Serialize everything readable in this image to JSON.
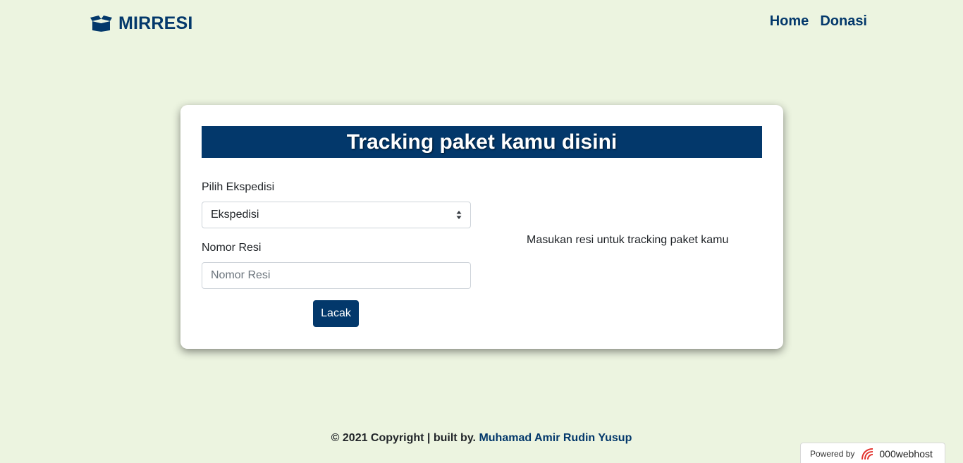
{
  "navbar": {
    "brand": "MIRRESI",
    "brand_icon": "box-open-icon",
    "links": [
      "Home",
      "Donasi"
    ]
  },
  "card": {
    "title": "Tracking paket kamu disini",
    "expedition_label": "Pilih Ekspedisi",
    "expedition_selected": "Ekspedisi",
    "resi_label": "Nomor Resi",
    "resi_placeholder": "Nomor Resi",
    "resi_value": "",
    "submit_label": "Lacak",
    "result_message": "Masukan resi untuk tracking paket kamu"
  },
  "footer": {
    "text": "© 2021 Copyright | built by.",
    "author": "Muhamad Amir Rudin Yusup"
  },
  "badge": {
    "prefix": "Powered by",
    "brand": "000webhost"
  },
  "colors": {
    "background": "#ecf4e0",
    "primary": "#03386b",
    "card": "#ffffff"
  }
}
